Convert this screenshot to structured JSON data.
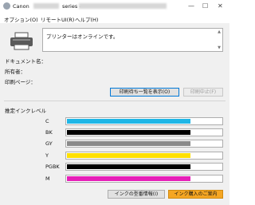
{
  "window": {
    "title_brand": "Canon",
    "title_series": "series -",
    "minimize_glyph": "—",
    "maximize_glyph": "☐",
    "close_glyph": "✕"
  },
  "menu": [
    {
      "label": "オプション(O)"
    },
    {
      "label": "リモートUI(R)"
    },
    {
      "label": "ヘルプ(H)"
    }
  ],
  "status": {
    "message": "プリンターはオンラインです。"
  },
  "job": {
    "document_label": "ドキュメント名：",
    "owner_label": "所有者：",
    "pages_label": "印刷ページ："
  },
  "buttons": {
    "show_queue": "印刷待ち一覧を表示(O)",
    "cancel_print": "印刷中止(F)",
    "ink_model_info": "インクの型番情報(I)",
    "ink_purchase": "インク購入のご案内"
  },
  "ink_heading": "推定インクレベル",
  "inks": [
    {
      "name": "C",
      "color": "#1fb6e6",
      "level": 0.8
    },
    {
      "name": "BK",
      "color": "#000000",
      "level": 0.8
    },
    {
      "name": "GY",
      "color": "#8a8a8a",
      "level": 0.8
    },
    {
      "name": "Y",
      "color": "#ffe000",
      "level": 0.8
    },
    {
      "name": "PGBK",
      "color": "#000000",
      "level": 0.8
    },
    {
      "name": "M",
      "color": "#e61fb8",
      "level": 0.8
    }
  ],
  "icons": [
    "app-icon",
    "printer-icon",
    "minimize-icon",
    "maximize-icon",
    "close-icon"
  ]
}
